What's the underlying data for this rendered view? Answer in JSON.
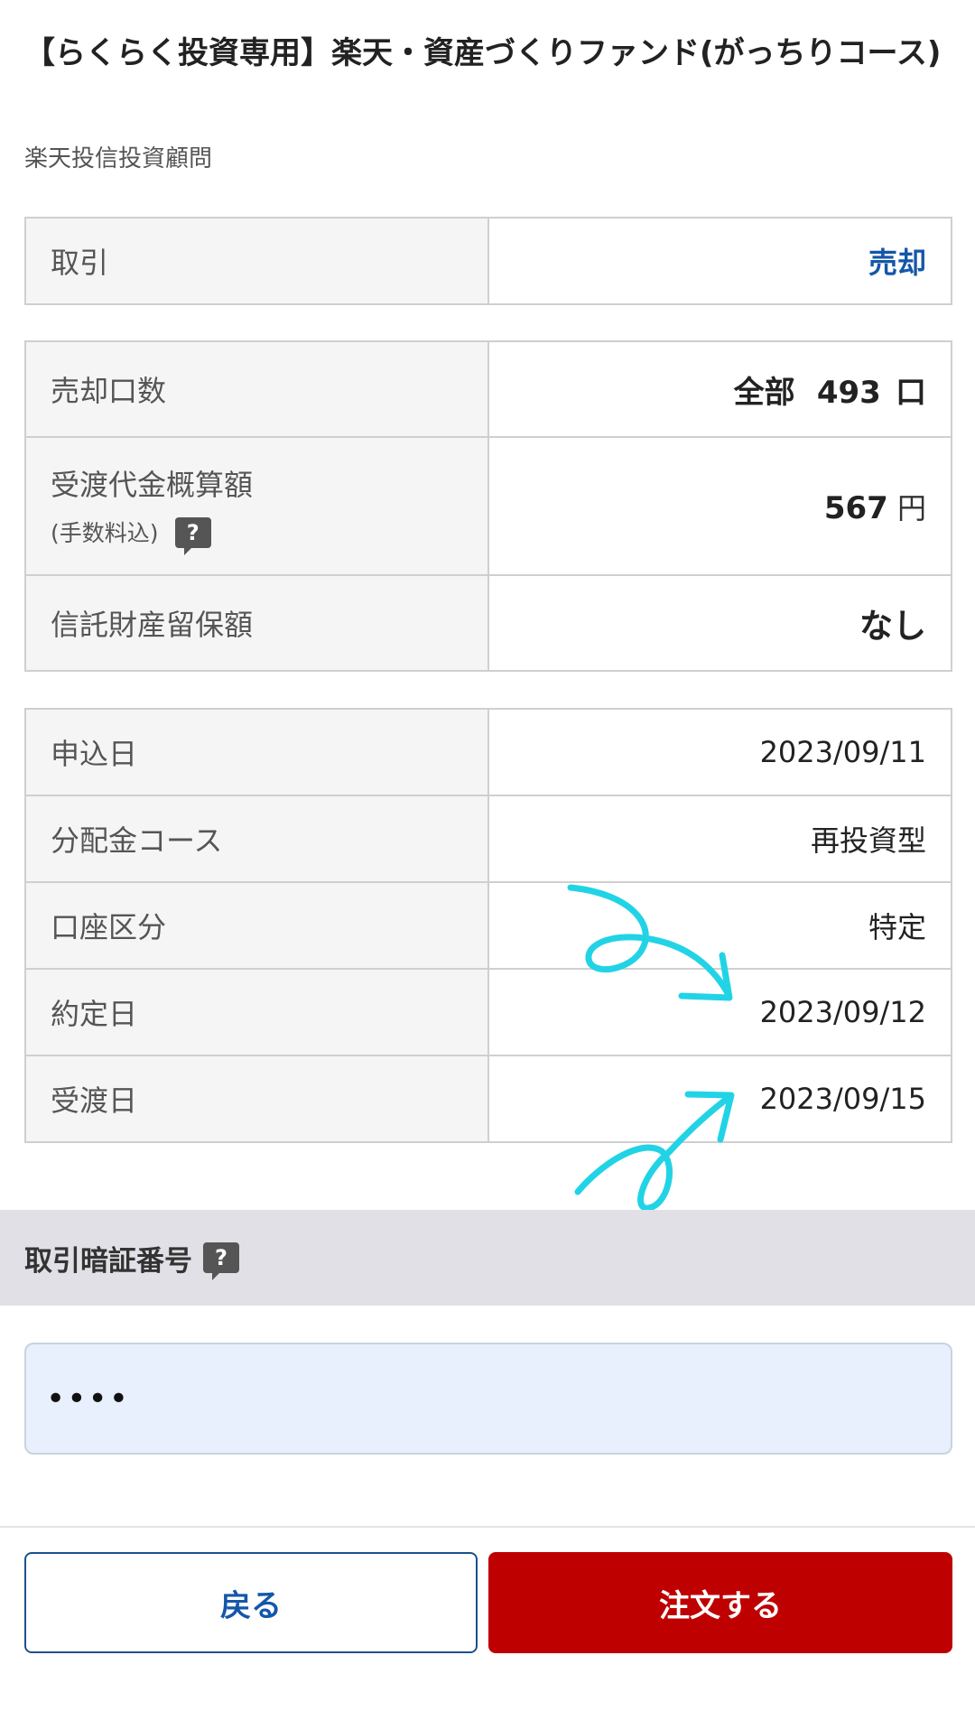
{
  "fund": {
    "title": "【らくらく投資専用】楽天・資産づくりファンド(がっちりコース)",
    "company": "楽天投信投資顧問"
  },
  "trade": {
    "label": "取引",
    "value": "売却"
  },
  "sale": {
    "units_label": "売却口数",
    "units_prefix": "全部",
    "units_value": "493",
    "units_suffix": "口",
    "amount_label": "受渡代金概算額",
    "amount_sub_label": "(手数料込)",
    "amount_value": "567",
    "amount_unit": "円",
    "reserve_label": "信託財産留保額",
    "reserve_value": "なし"
  },
  "details": [
    {
      "label": "申込日",
      "value": "2023/09/11"
    },
    {
      "label": "分配金コース",
      "value": "再投資型"
    },
    {
      "label": "口座区分",
      "value": "特定"
    },
    {
      "label": "約定日",
      "value": "2023/09/12"
    },
    {
      "label": "受渡日",
      "value": "2023/09/15"
    }
  ],
  "pin": {
    "label": "取引暗証番号",
    "value": "••••"
  },
  "help_icon_text": "?",
  "buttons": {
    "back": "戻る",
    "order": "注文する"
  },
  "colors": {
    "accent_blue": "#1457a8",
    "order_red": "#bf0000",
    "annotation": "#22d3e6"
  },
  "icons": [
    "help-icon",
    "annotation-arrow"
  ]
}
